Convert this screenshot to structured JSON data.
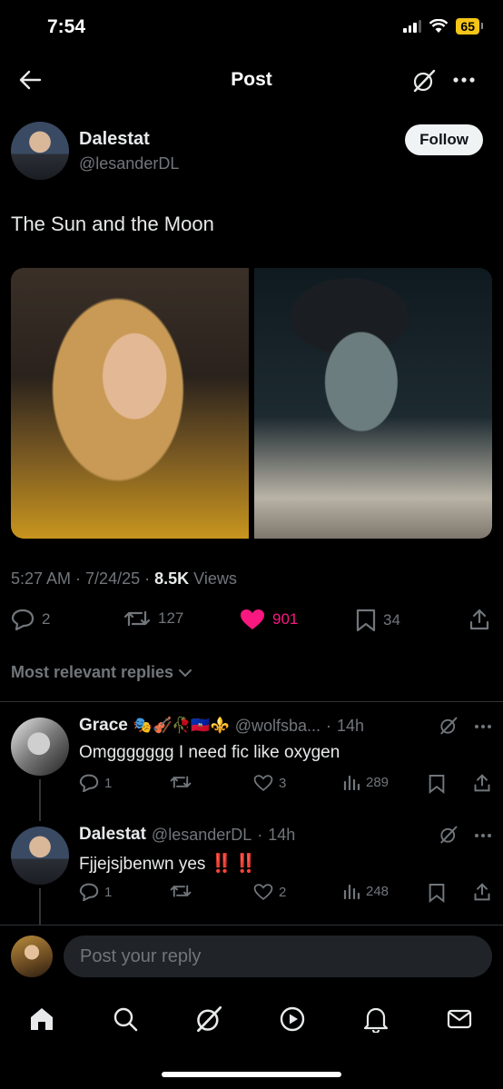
{
  "status_bar": {
    "time": "7:54",
    "battery": "65"
  },
  "header": {
    "title": "Post"
  },
  "post": {
    "author_name": "Dalestat",
    "author_handle": "@lesanderDL",
    "follow_label": "Follow",
    "text": "The Sun and the Moon",
    "time": "5:27 AM",
    "date": "7/24/25",
    "views_count": "8.5K",
    "views_label": "Views",
    "replies": "2",
    "reposts": "127",
    "likes": "901",
    "bookmarks": "34"
  },
  "replies_section": {
    "label": "Most relevant replies"
  },
  "replies": [
    {
      "name": "Grace",
      "emojis": "🎭🎻🥀🇭🇹⚜️",
      "handle": "@wolfsba...",
      "time": "14h",
      "text": "Omggggggg I need fic like oxygen",
      "replies": "1",
      "reposts": "",
      "likes": "3",
      "views": "289"
    },
    {
      "name": "Dalestat",
      "handle": "@lesanderDL",
      "time": "14h",
      "text": "Fjjejsjbenwn yes",
      "exclaim": "‼️ ‼️",
      "replies": "1",
      "reposts": "",
      "likes": "2",
      "views": "248"
    }
  ],
  "compose": {
    "placeholder": "Post your reply"
  },
  "colors": {
    "like": "#f91880",
    "muted": "#71767b",
    "bg": "#000000"
  }
}
